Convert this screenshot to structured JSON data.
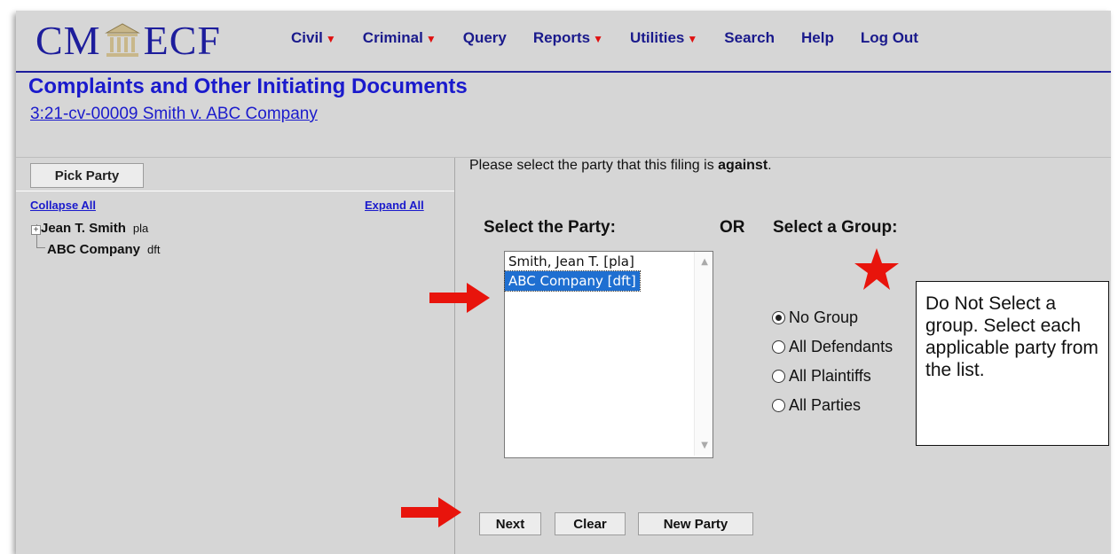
{
  "app": {
    "logo_left": "CM",
    "logo_right": "ECF"
  },
  "menu": [
    {
      "label": "Civil",
      "dropdown": true
    },
    {
      "label": "Criminal",
      "dropdown": true
    },
    {
      "label": "Query",
      "dropdown": false
    },
    {
      "label": "Reports",
      "dropdown": true
    },
    {
      "label": "Utilities",
      "dropdown": true
    },
    {
      "label": "Search",
      "dropdown": false
    },
    {
      "label": "Help",
      "dropdown": false
    },
    {
      "label": "Log Out",
      "dropdown": false
    }
  ],
  "page": {
    "title": "Complaints and Other Initiating Documents",
    "case_link": "3:21-cv-00009 Smith v. ABC Company"
  },
  "left_pane": {
    "tab": "Pick Party",
    "collapse_all": "Collapse All",
    "expand_all": "Expand All",
    "parties": [
      {
        "name": "Jean T. Smith",
        "role": "pla"
      },
      {
        "name": "ABC Company",
        "role": "dft"
      }
    ]
  },
  "main": {
    "instruction_prefix": "Please select the party that this filing is ",
    "instruction_emphasis": "against",
    "instruction_suffix": ".",
    "select_party_label": "Select the Party:",
    "or_label": "OR",
    "select_group_label": "Select a Group:",
    "party_list": [
      {
        "label": "Smith, Jean T. [pla]",
        "selected": false
      },
      {
        "label": "ABC Company [dft]",
        "selected": true
      }
    ],
    "groups": [
      {
        "label": "No Group",
        "checked": true
      },
      {
        "label": "All Defendants",
        "checked": false
      },
      {
        "label": "All Plaintiffs",
        "checked": false
      },
      {
        "label": "All Parties",
        "checked": false
      }
    ],
    "callout": "Do Not Select a group. Select each applicable party from the list."
  },
  "buttons": {
    "next": "Next",
    "clear": "Clear",
    "new_party": "New Party"
  },
  "colors": {
    "link_blue": "#1a1acc",
    "annotation_red": "#e8140c",
    "selection_blue": "#1f6fd1",
    "background_gray": "#d6d6d6"
  }
}
